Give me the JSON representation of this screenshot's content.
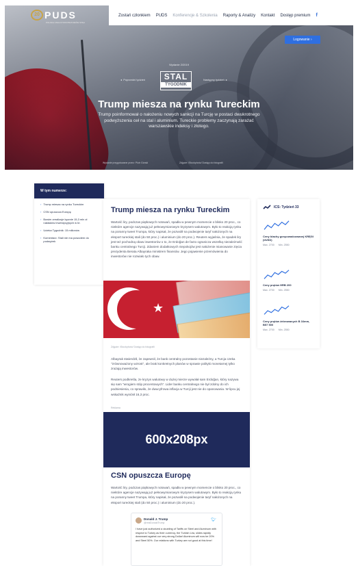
{
  "brand": {
    "mark": "20",
    "name": "PUDS",
    "sub": "POLSKA UNIA DYSTRYBUTORÓW STALI"
  },
  "nav": {
    "items": [
      "Zostań członkiem",
      "PUDS",
      "Konferencje & Szkolenia",
      "Raporty & Analizy",
      "Kontakt",
      "Dostęp premium"
    ],
    "facebook": "f"
  },
  "login": "Logowanie",
  "hero": {
    "issue": "Wydanie 2/2019",
    "logo_big": "STAL",
    "logo_small": "TYGODNIK",
    "prev": "Poprzedni tydzień",
    "next": "Następny tydzień",
    "title": "Trump miesza na rynku Tureckim",
    "lead": "Trump poinformował o nałożeniu nowych sankcji na Turcję w postaci dwukrotnego podwyższenia ceł na stal i aluminium. Tureckie problemy zaczynają zarażać warszawskie indeksy i złotego.",
    "credit1": "Wydanie przygotowane przez: Piotr Górski",
    "credit2": "Zdjęcie: iStockphoto/ Dostęp do fotografii"
  },
  "toc": {
    "title": "W tym numerze:",
    "items": [
      "Trump miesza na rynku Tureckim",
      "CSN opuszcza Europę",
      "Bowim zrealizuje łącznie 15,3 mln zł nakładów inwestycyjnych w br.",
      "Ucieka Tygodnik: 15 milionów",
      "Komentarz: Stali nie ma powodem do podwyżek"
    ]
  },
  "article": {
    "title": "Trump miesza na rynku Tureckim",
    "body1": "Wartość liry, podczas piątkowych notowań, spadła w pewnym momencie o blisko 20 proc., co niektóre agencje nazywają już pełnowymiarowym kryzysem walutowym. Było to reakcją rynku na poranny tweet Trumpa, który napisał, że pozwolił na podwojenie taryf nałożonych na eksport tureckiej stali (do 50 proc.) i aluminium (do 20 proc.). Reuters wyjaśnia, że spadek liry jest też pochodną obaw inwestorów o to, że Erdoğan de facto ogranicza wszelką niezależność banku centralnego Turcji. Zdaniem dodatkowych niepokojów jest nałożenie mianowanie zięcia prezydenta Berata Albayraka ministrem finansów. Jego pojawienie przemówienia do inwestorów nie rozwiało tych obaw.",
    "photo_caption": "Zdjęcie: iStockphoto/ Dostęp do fotografii",
    "body2": "Albayrak stwierdził, że zapewnił, że bank centralny pozostanie niezależny, a Turcja czeka \"zrównoważony wzrost\", ale brak konkretnych planów w sprawie polityki monetarnej tylko zrażają inwestorów.",
    "body3": "Reuters podkreśla, że kryzys walutowy w dużej mierze wywołał sam Erdoğan, który nazywa się sam \"wrogiem stóp procentowych\". Lider banku centralnego nie był zdolny do ich podniesienia, co sprawiło, że dwucyfrowa inflacja w Turcji jest nie do opanowania. W lipcu jej wskaźnik wyniósł 16,3 proc.",
    "ad_label": "Reklama",
    "ad_text": "600x208px",
    "title2": "CSN opuszcza Europę",
    "body4": "Wartość liry, podczas piątkowych notowań, spadła w pewnym momencie o blisko 20 proc., co niektóre agencje nazywają już pełnowymiarowym kryzysem walutowym. Było to reakcją rynku na poranny tweet Trumpa, który napisał, że pozwolił na podwojenie taryf nałożonych na eksport tureckiej stali (do 50 proc.) i aluminium (do 20 proc.).",
    "tweet": {
      "name": "Donald J. Trump",
      "handle": "@realDonaldTrump",
      "text": "I have just authorized a doubling of Tariffs on Steel and Aluminum with respect to Turkey as their currency, the Turkish Lira, slides rapidly downward against our very strong Dollar! Aluminum will now be 20% and Steel 50%. Our relations with Turkey are not good at this time!"
    }
  },
  "sidebar": {
    "title": "ICS: Tydzień 33",
    "items": [
      {
        "label": "Ceny blachy gorącowalcowanej KRĘGI (t/USD)",
        "max": "Max. 2700",
        "min": "Min. 2550",
        "points": [
          0.2,
          0.55,
          0.35,
          0.7,
          0.5,
          0.8,
          0.6,
          0.9
        ]
      },
      {
        "label": "Ceny prętów HRB 200",
        "max": "Max. 2700",
        "min": "Min. 2550",
        "points": [
          0.15,
          0.45,
          0.3,
          0.65,
          0.5,
          0.75,
          0.6,
          0.85
        ]
      },
      {
        "label": "Ceny prętów żebrowanych B 16mm, B57 500",
        "max": "Max. 2700",
        "min": "Min. 2550",
        "points": [
          0.2,
          0.5,
          0.35,
          0.6,
          0.45,
          0.8,
          0.65,
          0.9
        ]
      }
    ]
  }
}
